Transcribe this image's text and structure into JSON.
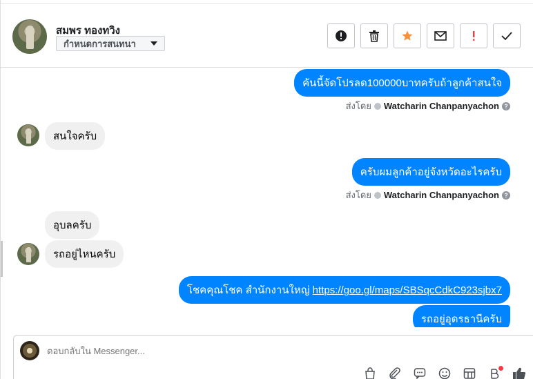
{
  "header": {
    "contact_name": "สมพร ทองทวิง",
    "assign_dropdown": "กำหนดการสนทนา",
    "actions": [
      {
        "icon": "exclamation-circle-icon"
      },
      {
        "icon": "trash-icon"
      },
      {
        "icon": "star-icon",
        "color": "#f7923b"
      },
      {
        "icon": "envelope-icon"
      },
      {
        "icon": "exclamation-mark-icon",
        "color": "#fa383e"
      },
      {
        "icon": "checkmark-icon"
      }
    ]
  },
  "messages": {
    "m1": {
      "text": "คันนี้จัดโปรลด100000บาทครับถ้าลูกค้าสนใจ",
      "sent_by_label": "ส่งโดย",
      "sender": "Watcharin Chanpanyachon"
    },
    "m2": {
      "text": "สนใจครับ"
    },
    "m3": {
      "text": "ครับผมลูกค้าอยู่จังหวัดอะไรครับ",
      "sent_by_label": "ส่งโดย",
      "sender": "Watcharin Chanpanyachon"
    },
    "m4": {
      "text": "อุบลครับ"
    },
    "m5": {
      "text": "รถอยู่ไหนครับ"
    },
    "m6": {
      "text_prefix": "โชคคุณโชค สำนักงานใหญ่ ",
      "link": "https://goo.gl/maps/SBSqcCdkC923sjbx7"
    },
    "m7": {
      "text": "รถอยู่อุดรธานีครับ"
    }
  },
  "composer": {
    "placeholder": "ตอบกลับใน Messenger...",
    "tools": [
      "bag-icon",
      "paperclip-icon",
      "quick-reply-icon",
      "emoji-icon",
      "template-icon",
      "payment-icon",
      "like-icon"
    ]
  },
  "colors": {
    "outgoing_bubble": "#0084ff",
    "incoming_bubble": "#f1f0f0"
  }
}
